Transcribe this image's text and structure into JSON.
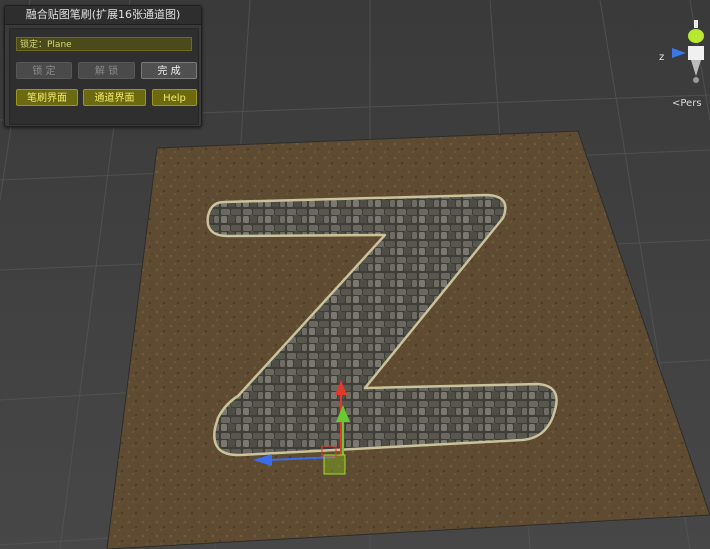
{
  "panel": {
    "title": "融合贴图笔刷(扩展16张通道图)",
    "lock_field": "锁定：Plane",
    "buttons": {
      "lock": "锁 定",
      "unlock": "解 锁",
      "done": "完 成",
      "brush_ui": "笔刷界面",
      "channel_ui": "通道界面",
      "help": "Help"
    }
  },
  "gizmo": {
    "z_axis_label": "z",
    "view_label": "<Pers"
  },
  "colors": {
    "ground": "#5c4a30",
    "stone_path": "#5a5a55",
    "axis_x": "#e23a2a",
    "axis_y": "#6ac832",
    "axis_z": "#3a6ee8"
  }
}
